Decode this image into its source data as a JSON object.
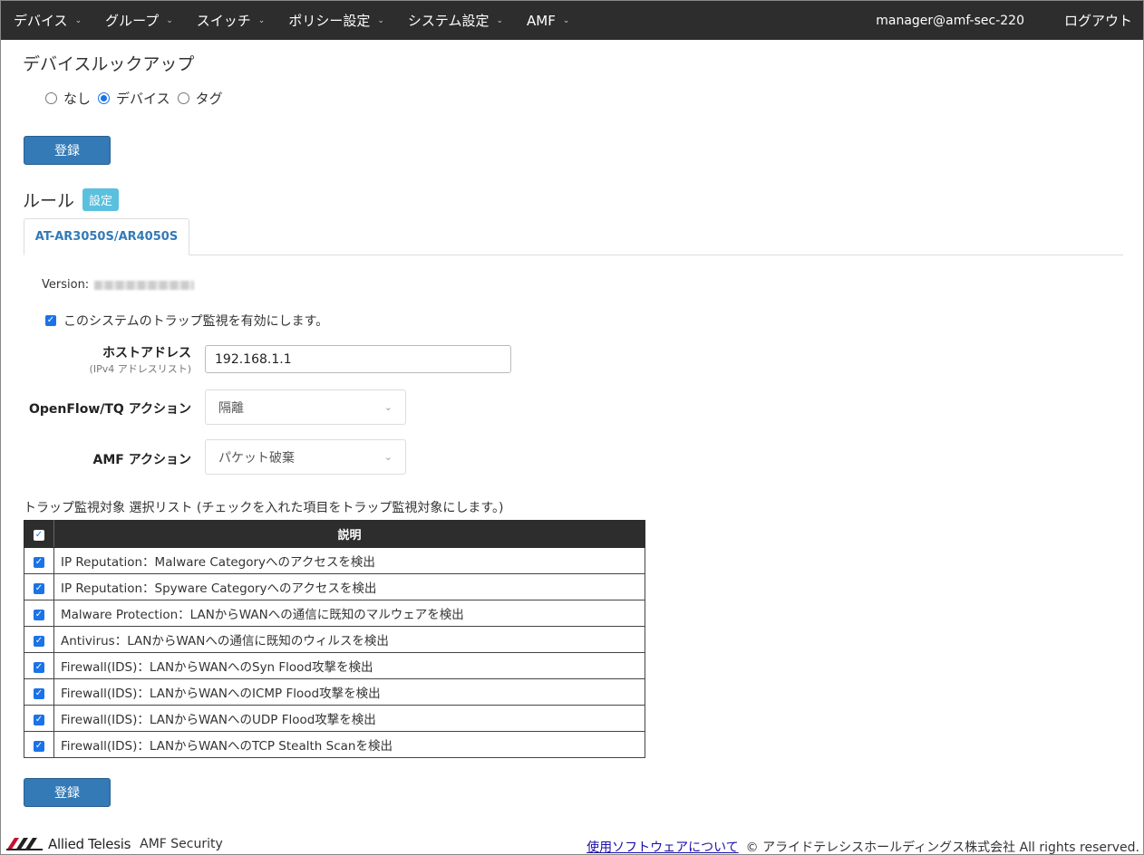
{
  "nav": {
    "items": [
      "デバイス",
      "グループ",
      "スイッチ",
      "ポリシー設定",
      "システム設定",
      "AMF"
    ],
    "user": "manager@amf-sec-220",
    "logout": "ログアウト"
  },
  "lookup": {
    "title": "デバイスルックアップ",
    "options": [
      "なし",
      "デバイス",
      "タグ"
    ],
    "selected": "デバイス",
    "register_label": "登録"
  },
  "rule": {
    "title": "ルール",
    "badge": "設定",
    "tab": "AT-AR3050S/AR4050S",
    "version_label": "Version:",
    "enable_label": "このシステムのトラップ監視を有効にします。",
    "enable_checked": true,
    "host_label": "ホストアドレス",
    "host_sub": "(IPv4 アドレスリスト)",
    "host_value": "192.168.1.1",
    "openflow_label": "OpenFlow/TQ アクション",
    "openflow_value": "隔離",
    "amf_label": "AMF アクション",
    "amf_value": "パケット破棄"
  },
  "trap_list": {
    "caption": "トラップ監視対象 選択リスト (チェックを入れた項目をトラップ監視対象にします。)",
    "header_desc": "説明",
    "rows": [
      {
        "checked": true,
        "text": "IP Reputation：Malware Categoryへのアクセスを検出"
      },
      {
        "checked": true,
        "text": "IP Reputation：Spyware Categoryへのアクセスを検出"
      },
      {
        "checked": true,
        "text": "Malware Protection：LANからWANへの通信に既知のマルウェアを検出"
      },
      {
        "checked": true,
        "text": "Antivirus：LANからWANへの通信に既知のウィルスを検出"
      },
      {
        "checked": true,
        "text": "Firewall(IDS)：LANからWANへのSyn Flood攻撃を検出"
      },
      {
        "checked": true,
        "text": "Firewall(IDS)：LANからWANへのICMP Flood攻撃を検出"
      },
      {
        "checked": true,
        "text": "Firewall(IDS)：LANからWANへのUDP Flood攻撃を検出"
      },
      {
        "checked": true,
        "text": "Firewall(IDS)：LANからWANへのTCP Stealth Scanを検出"
      }
    ],
    "register_label": "登録"
  },
  "footer": {
    "logo_text": "Allied Telesis",
    "product": "AMF Security",
    "link": "使用ソフトウェアについて",
    "copyright": "© アライドテレシスホールディングス株式会社 All rights reserved."
  },
  "colors": {
    "navbar": "#2d2d2d",
    "primary": "#337ab7",
    "badge": "#5bc0de",
    "accent": "#1a73e8"
  }
}
